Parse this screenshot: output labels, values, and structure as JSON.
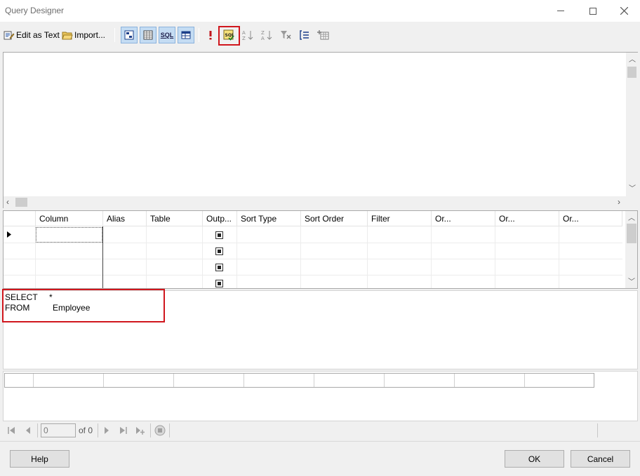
{
  "window": {
    "title": "Query Designer",
    "controls": {
      "minimize": "—",
      "maximize": "☐",
      "close": "✕"
    }
  },
  "toolbar": {
    "edit_as_text": "Edit as Text",
    "import": "Import...",
    "sql_icon_label": "SQL"
  },
  "grid": {
    "columns": [
      "Column",
      "Alias",
      "Table",
      "Outp...",
      "Sort Type",
      "Sort Order",
      "Filter",
      "Or...",
      "Or...",
      "Or..."
    ],
    "row_count": 4
  },
  "sql": {
    "line1_keyword": "SELECT",
    "line1_value": "*",
    "line2_keyword": "FROM",
    "line2_value": "Employee"
  },
  "navigator": {
    "page_value": "0",
    "page_of": "of 0"
  },
  "buttons": {
    "help": "Help",
    "ok": "OK",
    "cancel": "Cancel"
  },
  "colors": {
    "highlight": "#d0161d",
    "pressed_bg": "#c4dcf3",
    "pressed_border": "#8cb3dc"
  }
}
